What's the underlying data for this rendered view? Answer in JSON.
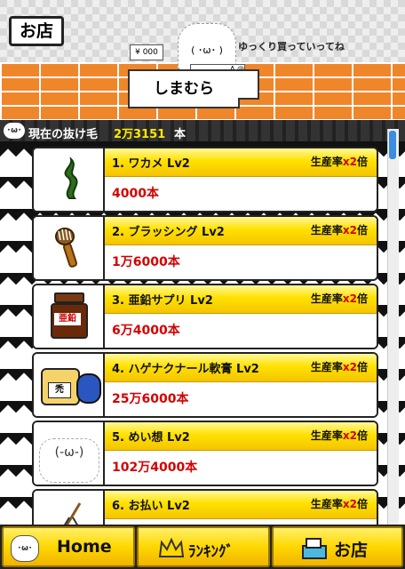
{
  "shop": {
    "button_label": "お店",
    "greeting": "ゆっくり買っていってね",
    "counter_name": "しまむら",
    "register_text": "¥ 000",
    "mascot_face": "( ･ω･ )",
    "counter_mark": "A @"
  },
  "status": {
    "label": "現在の抜け毛",
    "value": "2万3151",
    "unit": "本"
  },
  "items": [
    {
      "name": "1. ワカメ Lv2",
      "rate_label": "生産率",
      "rate_mul": "x2",
      "rate_unit": "倍",
      "cost": "4000本",
      "icon": "seaweed-icon"
    },
    {
      "name": "2. ブラッシング Lv2",
      "rate_label": "生産率",
      "rate_mul": "x2",
      "rate_unit": "倍",
      "cost": "1万6000本",
      "icon": "brush-icon"
    },
    {
      "name": "3. 亜鉛サプリ Lv2",
      "rate_label": "生産率",
      "rate_mul": "x2",
      "rate_unit": "倍",
      "cost": "6万4000本",
      "icon": "zinc-supplement-icon",
      "icon_text": "亜鉛"
    },
    {
      "name": "4. ハゲナクナール軟膏 Lv2",
      "rate_label": "生産率",
      "rate_mul": "x2",
      "rate_unit": "倍",
      "cost": "25万6000本",
      "icon": "ointment-icon",
      "icon_text": "禿"
    },
    {
      "name": "5. めい想 Lv2",
      "rate_label": "生産率",
      "rate_mul": "x2",
      "rate_unit": "倍",
      "cost": "102万4000本",
      "icon": "meditation-icon",
      "icon_text": "(-ω-)"
    },
    {
      "name": "6. お払い Lv2",
      "rate_label": "生産率",
      "rate_mul": "x2",
      "rate_unit": "倍",
      "cost": "",
      "icon": "purification-wand-icon"
    }
  ],
  "nav": {
    "home": "Home",
    "ranking": "ﾗﾝｷﾝｸﾞ",
    "shop": "お店"
  },
  "colors": {
    "accent_yellow": "#ffe100",
    "cost_red": "#d40000",
    "brick_orange": "#f0862a",
    "scroll_blue": "#3a8de0"
  }
}
